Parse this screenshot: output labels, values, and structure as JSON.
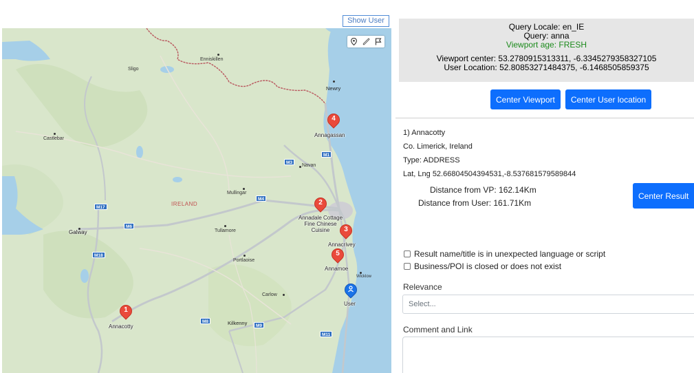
{
  "map": {
    "show_user_label": "Show User",
    "tools": [
      "pin-tool-icon",
      "ruler-tool-icon",
      "flag-tool-icon"
    ],
    "places": {
      "enniskillen": "Enniskillen",
      "sligo": "Sligo",
      "newry": "Newry",
      "castlebar": "Castlebar",
      "navan": "Navan",
      "mullingar": "Mullingar",
      "ireland": "IRELAND",
      "galway": "Galway",
      "tullamore": "Tullamore",
      "portlaoise": "Portlaoise",
      "carlow": "Carlow",
      "wicklow": "Wicklow",
      "kilkenny": "Kilkenny"
    },
    "roads": [
      "M3",
      "M1",
      "M4",
      "M17",
      "M6",
      "M18",
      "M8",
      "M9",
      "M11"
    ],
    "markers": [
      {
        "num": "1",
        "label": "Annacotty"
      },
      {
        "num": "2",
        "label": "Annadale Cottage Fine Chinese Cuisine"
      },
      {
        "num": "3",
        "label": "Annacrivey"
      },
      {
        "num": "4",
        "label": "Annagassan"
      },
      {
        "num": "5",
        "label": "Annamoe"
      }
    ],
    "user_label": "User"
  },
  "info": {
    "locale": "Query Locale: en_IE",
    "query": "Query: anna",
    "viewport_age": "Viewport age: FRESH",
    "viewport_center": "Viewport center: 53.2780915313311, -6.3345279358327105",
    "user_location": "User Location: 52.80853271484375, -6.1468505859375"
  },
  "buttons": {
    "center_viewport": "Center Viewport",
    "center_user": "Center User location",
    "center_result": "Center Result"
  },
  "result": {
    "title": "1) Annacotty",
    "region": "Co. Limerick, Ireland",
    "type": "Type: ADDRESS",
    "latlng": "Lat, Lng 52.66804504394531,-8.537681579589844",
    "dist_vp": "Distance from VP: 162.14Km",
    "dist_user": "Distance from User: 161.71Km"
  },
  "checks": {
    "unexpected_language": "Result name/title is in unexpected language or script",
    "closed": "Business/POI is closed or does not exist"
  },
  "relevance": {
    "label": "Relevance",
    "placeholder": "Select..."
  },
  "comment": {
    "label": "Comment and Link"
  },
  "colors": {
    "accent": "#0d6efd",
    "marker": "#ea4a3b",
    "user_marker": "#1a73e8",
    "fresh": "#1b8a1b"
  }
}
